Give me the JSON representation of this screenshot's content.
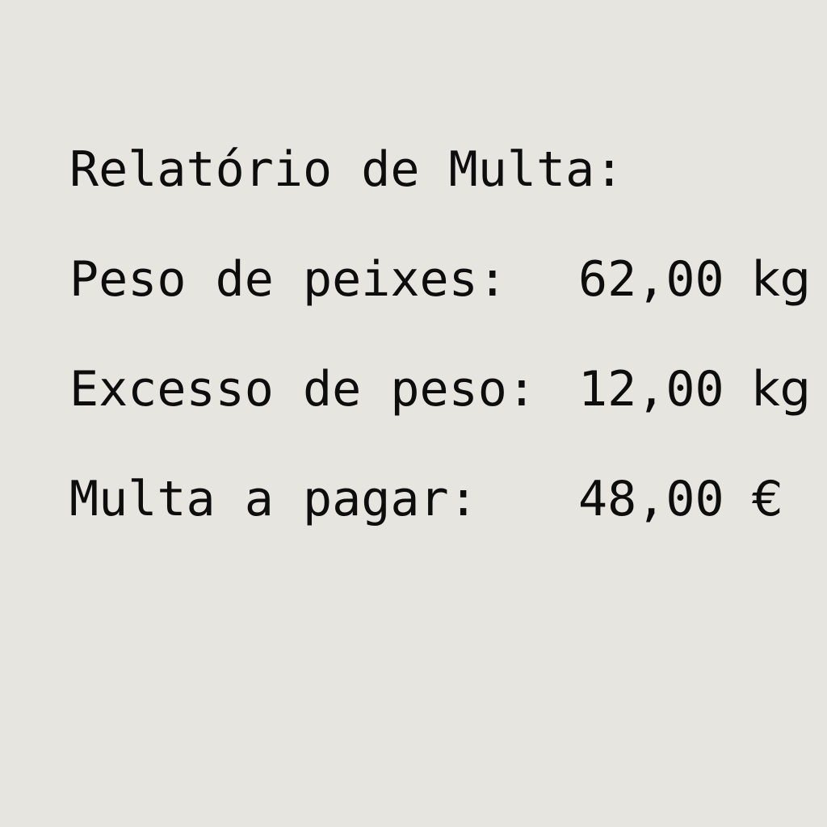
{
  "report": {
    "title": "Relatório de Multa:",
    "rows": [
      {
        "label": "Peso de peixes:",
        "value": "62,00",
        "unit": "kg"
      },
      {
        "label": "Excesso de peso:",
        "value": "12,00",
        "unit": "kg"
      },
      {
        "label": "Multa a pagar:",
        "value": "48,00",
        "unit": "€"
      }
    ]
  }
}
